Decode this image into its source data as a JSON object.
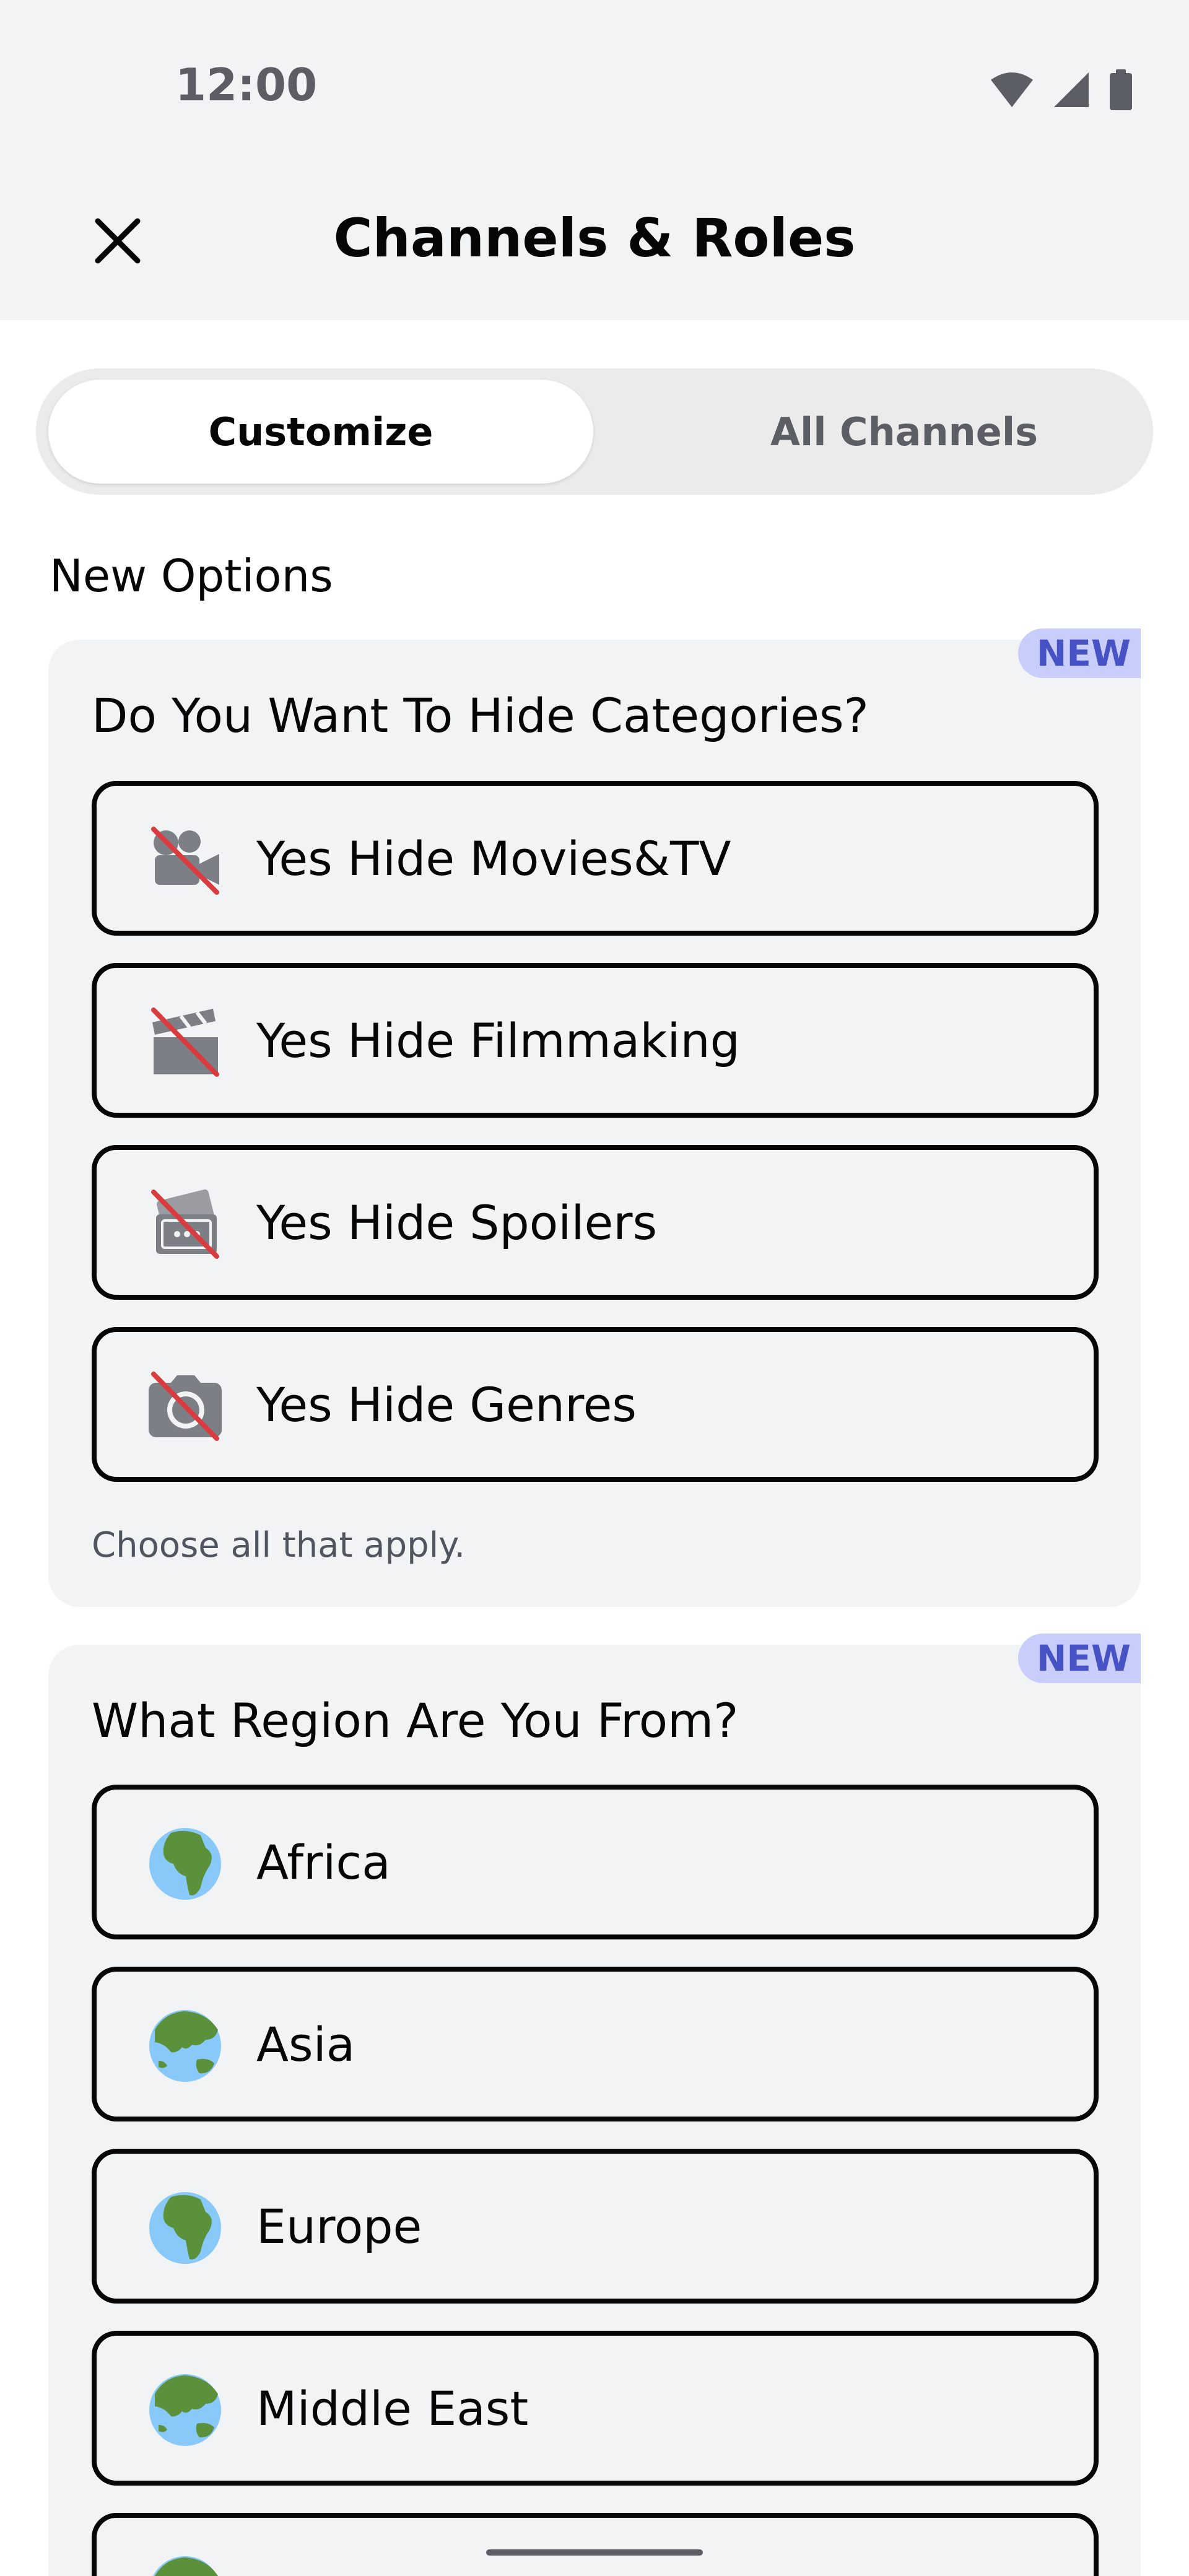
{
  "status_bar": {
    "time": "12:00",
    "icons": [
      "wifi-icon",
      "signal-icon",
      "battery-icon"
    ]
  },
  "header": {
    "title": "Channels & Roles",
    "close_icon": "close-icon"
  },
  "tabs": [
    {
      "label": "Customize",
      "active": true
    },
    {
      "label": "All Channels",
      "active": false
    }
  ],
  "section_label": "New Options",
  "cards": [
    {
      "badge": "NEW",
      "question": "Do You Want To Hide Categories?",
      "options": [
        {
          "label": "Yes Hide Movies&TV",
          "icon": "movie-camera-crossed-icon"
        },
        {
          "label": "Yes Hide Filmmaking",
          "icon": "clapperboard-crossed-icon"
        },
        {
          "label": "Yes Hide Spoilers",
          "icon": "tickets-crossed-icon"
        },
        {
          "label": "Yes Hide Genres",
          "icon": "camera-crossed-icon"
        }
      ],
      "hint": "Choose all that apply."
    },
    {
      "badge": "NEW",
      "question": "What Region Are You From?",
      "options": [
        {
          "label": "Africa",
          "icon": "globe-africa-icon"
        },
        {
          "label": "Asia",
          "icon": "globe-asia-icon"
        },
        {
          "label": "Europe",
          "icon": "globe-europe-icon"
        },
        {
          "label": "Middle East",
          "icon": "globe-asia-icon"
        },
        {
          "label": "",
          "icon": "globe-asia-icon"
        }
      ]
    }
  ],
  "colors": {
    "background": "#ffffff",
    "surface": "#f2f3f5",
    "badge_bg": "#c9cdfb",
    "badge_text": "#4752c4",
    "strike_red": "#d83c3e"
  }
}
